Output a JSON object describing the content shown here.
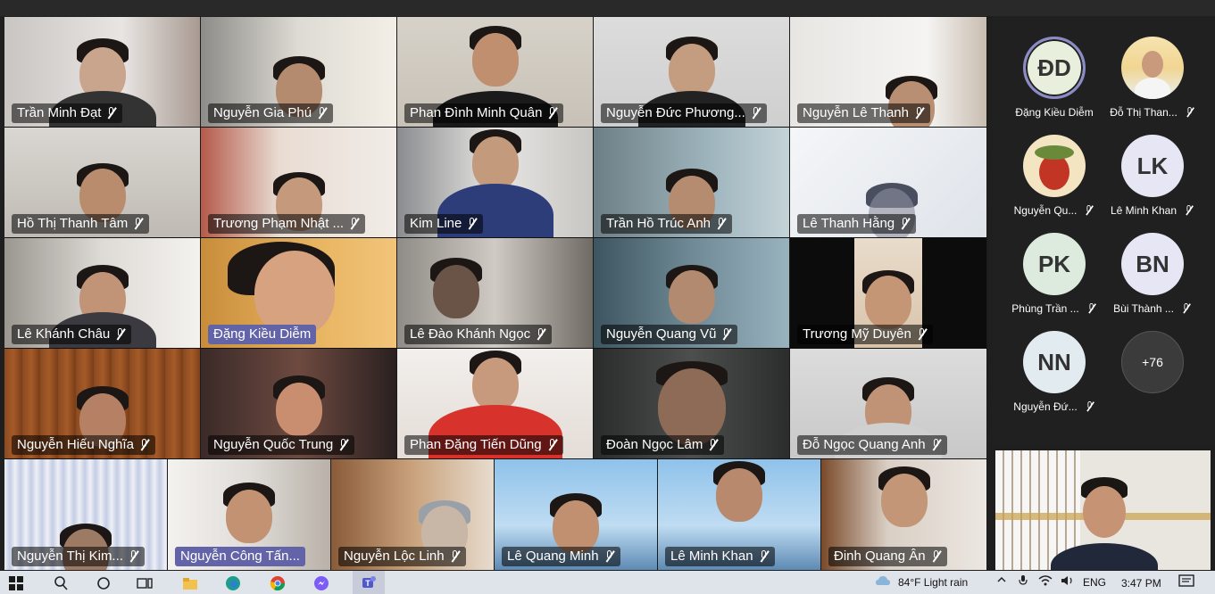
{
  "meeting": {
    "tiles_row1": [
      {
        "name": "Trần Minh Đạt",
        "muted": true
      },
      {
        "name": "Nguyễn Gia Phú",
        "muted": true
      },
      {
        "name": "Phan Đình Minh Quân",
        "muted": true
      },
      {
        "name": "Nguyễn Đức Phương...",
        "muted": true
      },
      {
        "name": "Nguyễn Lê Thanh",
        "muted": true
      }
    ],
    "tiles_row2": [
      {
        "name": "Hồ Thị Thanh Tâm",
        "muted": true
      },
      {
        "name": "Trương Phạm Nhật ...",
        "muted": true
      },
      {
        "name": "Kim Line",
        "muted": true
      },
      {
        "name": "Trần Hồ Trúc Anh",
        "muted": true
      },
      {
        "name": "Lê Thanh Hằng",
        "muted": true
      }
    ],
    "tiles_row3": [
      {
        "name": "Lê Khánh Châu",
        "muted": true
      },
      {
        "name": "Đặng Kiều Diễm",
        "muted": false,
        "speaking": true
      },
      {
        "name": "Lê Đào Khánh Ngọc",
        "muted": true
      },
      {
        "name": "Nguyễn Quang Vũ",
        "muted": true
      },
      {
        "name": "Trương Mỹ Duyên",
        "muted": true
      }
    ],
    "tiles_row4": [
      {
        "name": "Nguyễn Hiếu Nghĩa",
        "muted": true
      },
      {
        "name": "Nguyễn Quốc Trung",
        "muted": true
      },
      {
        "name": "Phan Đặng Tiến Dũng",
        "muted": true
      },
      {
        "name": "Đoàn Ngọc Lâm",
        "muted": true
      },
      {
        "name": "Đỗ Ngọc Quang Anh",
        "muted": true
      }
    ],
    "tiles_row5": [
      {
        "name": "Nguyễn Thị Kim...",
        "muted": true
      },
      {
        "name": "Nguyễn Công Tấn...",
        "muted": false,
        "speaking": true
      },
      {
        "name": "Nguyễn Lộc Linh",
        "muted": true
      },
      {
        "name": "Lê Quang Minh",
        "muted": true
      },
      {
        "name": "Lê Minh Khan",
        "muted": true
      },
      {
        "name": "Đinh Quang Ân",
        "muted": true
      }
    ]
  },
  "sidebar": {
    "participants": [
      {
        "initials": "ĐD",
        "label": "Đặng Kiều Diễm",
        "muted": false,
        "bg": "#e8efdc"
      },
      {
        "initials": "",
        "label": "Đỗ Thị Than...",
        "muted": true,
        "bg": "#f2d9a8",
        "photo": "girl"
      },
      {
        "initials": "",
        "label": "Nguyễn Qu...",
        "muted": true,
        "bg": "#f3e4c2",
        "photo": "cartoon"
      },
      {
        "initials": "LK",
        "label": "Lê Minh Khan",
        "muted": true,
        "bg": "#e6e6f5"
      },
      {
        "initials": "PK",
        "label": "Phùng Trần ...",
        "muted": true,
        "bg": "#dcebde"
      },
      {
        "initials": "BN",
        "label": "Bùi Thành ...",
        "muted": true,
        "bg": "#e6e6f5"
      },
      {
        "initials": "NN",
        "label": "Nguyễn Đứ...",
        "muted": true,
        "bg": "#e2ecf0"
      }
    ],
    "overflow_label": "+76"
  },
  "taskbar": {
    "weather": "84°F  Light rain",
    "language": "ENG",
    "time": "3:47 PM",
    "colors": {
      "accent": "#6264a7",
      "bg": "#dfe3ea"
    }
  }
}
